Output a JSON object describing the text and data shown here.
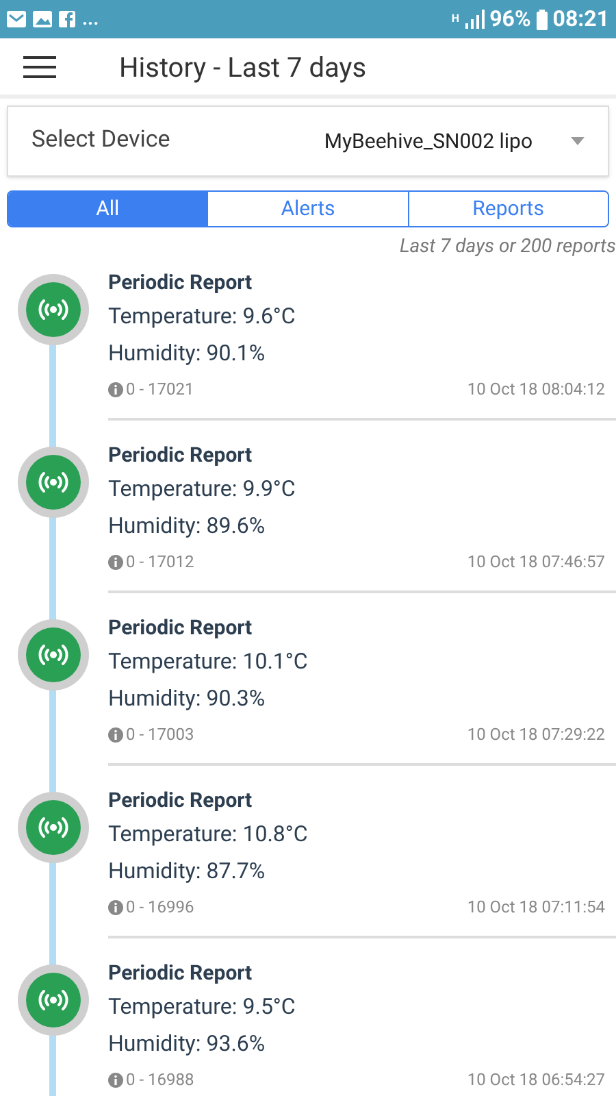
{
  "status_bar": {
    "notifications": "...",
    "network": "H",
    "battery": "96%",
    "time": "08:21"
  },
  "header": {
    "title": "History - Last 7 days"
  },
  "device_select": {
    "label": "Select Device",
    "value": "MyBeehive_SN002 lipo"
  },
  "tabs": [
    {
      "label": "All",
      "selected": true
    },
    {
      "label": "Alerts",
      "selected": false
    },
    {
      "label": "Reports",
      "selected": false
    }
  ],
  "note": "Last 7 days or 200 reports",
  "entries": [
    {
      "title": "Periodic Report",
      "temperature": "Temperature: 9.6°C",
      "humidity": "Humidity: 90.1%",
      "id": "0 - 17021",
      "time": "10 Oct 18 08:04:12"
    },
    {
      "title": "Periodic Report",
      "temperature": "Temperature: 9.9°C",
      "humidity": "Humidity: 89.6%",
      "id": "0 - 17012",
      "time": "10 Oct 18 07:46:57"
    },
    {
      "title": "Periodic Report",
      "temperature": "Temperature: 10.1°C",
      "humidity": "Humidity: 90.3%",
      "id": "0 - 17003",
      "time": "10 Oct 18 07:29:22"
    },
    {
      "title": "Periodic Report",
      "temperature": "Temperature: 10.8°C",
      "humidity": "Humidity: 87.7%",
      "id": "0 - 16996",
      "time": "10 Oct 18 07:11:54"
    },
    {
      "title": "Periodic Report",
      "temperature": "Temperature: 9.5°C",
      "humidity": "Humidity: 93.6%",
      "id": "0 - 16988",
      "time": "10 Oct 18 06:54:27"
    }
  ]
}
